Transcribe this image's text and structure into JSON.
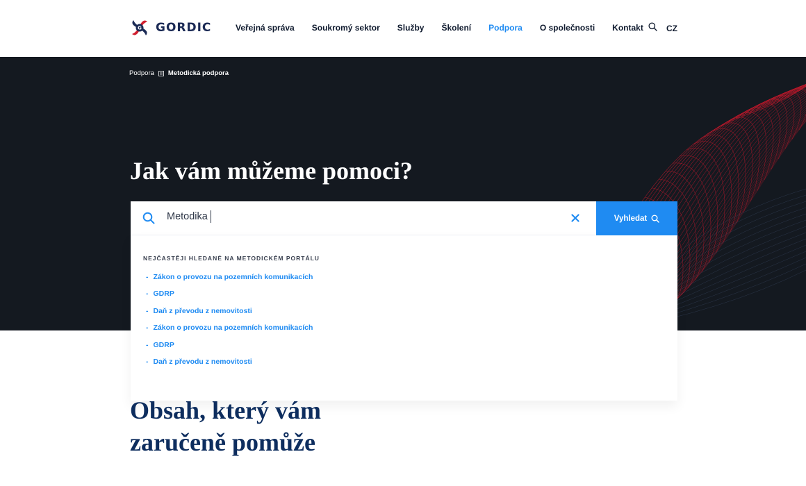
{
  "brand": {
    "name": "GORDIC"
  },
  "nav": {
    "items": [
      {
        "label": "Veřejná správa"
      },
      {
        "label": "Soukromý sektor"
      },
      {
        "label": "Služby"
      },
      {
        "label": "Školení"
      },
      {
        "label": "Podpora"
      },
      {
        "label": "O společnosti"
      },
      {
        "label": "Kontakt"
      }
    ],
    "active": "Podpora",
    "lang": "CZ"
  },
  "breadcrumb": {
    "parent": "Podpora",
    "current": "Metodická podpora"
  },
  "hero": {
    "title": "Jak vám můžeme pomoci?"
  },
  "search": {
    "value": "Metodika",
    "button_label": "Vyhledat"
  },
  "dropdown": {
    "heading": "NEJČASTĚJI HLEDANÉ NA METODICKÉM PORTÁLU",
    "dash": "-",
    "suggestions": [
      "Zákon o provozu na pozemních komunikacích",
      "GDRP",
      "Daň z převodu z nemovitosti",
      "Zákon o provozu na pozemních komunikacích",
      "GDRP",
      "Daň z převodu z nemovitosti"
    ]
  },
  "section": {
    "title": "Obsah, který vám zaručeně pomůže"
  },
  "colors": {
    "accent": "#1f8bf2",
    "hero_bg": "#141920",
    "mesh": "#c3192c",
    "heading_navy": "#0d2d5e"
  },
  "icons": {
    "search": "search-icon",
    "clear": "close-icon",
    "breadcrumb_separator": "page-icon"
  }
}
